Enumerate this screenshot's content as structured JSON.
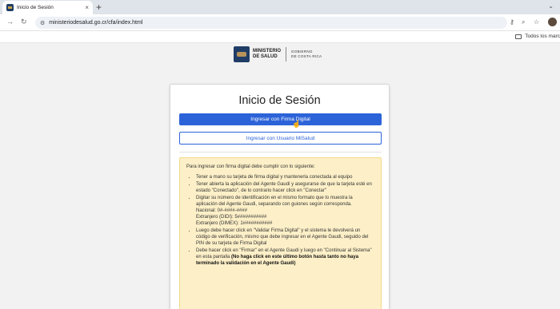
{
  "browser": {
    "tab_title": "Inicio de Sesión",
    "url": "ministeriodesalud.go.cr/cfa/index.html",
    "bookmark_folder": "Todos los marc"
  },
  "logo": {
    "line1": "MINISTERIO",
    "line2": "DE SALUD",
    "gob1": "GOBIERNO",
    "gob2": "DE COSTA RICA"
  },
  "login": {
    "title": "Inicio de Sesión",
    "btn_firma": "Ingresar con Firma Digital",
    "btn_usuario": "Ingresar con Usuario MiSalud"
  },
  "info": {
    "intro": "Para ingresar con firma digital debe cumplir con lo siguiente:",
    "item1": "Tener a mano su tarjeta de firma digital y mantenerla conectada al equipo",
    "item2": "Tener abierta la aplicación del Agente Gaudi y asegurarse de que la tarjeta esté en estado \"Conectado\", de lo contrario hacer click en \"Conectar\"",
    "item3": "Digitar su número de identificación en el mismo formato que lo muestra la aplicación del Agente Gaudi, separando con guiones según corresponda.",
    "fmt_nacional": "Nacional: 0#-####-####",
    "fmt_didi": "Extranjero (DIDI): 5###########",
    "fmt_dimex": "Extranjero (DIMEX): 1###########",
    "item4": "Luego debe hacer click en \"Validar Firma Digital\" y el sistema le devolverá un código de verificación, mismo que debe ingresar en el Agente Gaudi, seguido del PIN de su tarjeta de Firma Digital",
    "item5": "Debe hacer click en \"Firmar\" en el Agente Gaudi y luego en \"Continuar al Sistema\" en esta pantalla",
    "item5_bold": "(No haga click en este último botón hasta tanto no haya terminado la validación en el Agente Gaudi)"
  }
}
